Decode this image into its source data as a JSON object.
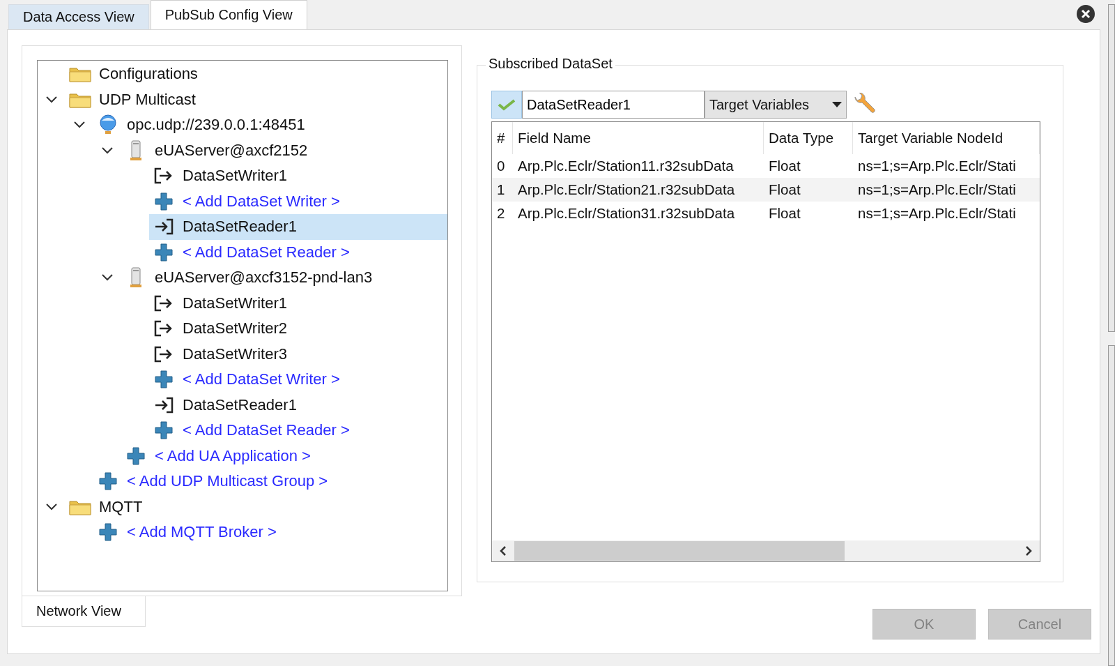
{
  "tabs": [
    {
      "label": "Data Access View",
      "selected": false
    },
    {
      "label": "PubSub Config View",
      "selected": true
    }
  ],
  "tree": [
    {
      "kind": "folder",
      "label": "Configurations",
      "selected": false
    },
    {
      "kind": "folder",
      "label": "UDP Multicast",
      "expanded": true,
      "selected": false,
      "children": [
        {
          "kind": "globe",
          "label": "opc.udp://239.0.0.1:48451",
          "expanded": true,
          "selected": false,
          "children": [
            {
              "kind": "server",
              "label": "eUAServer@axcf2152",
              "expanded": true,
              "selected": false,
              "children": [
                {
                  "kind": "writer",
                  "label": "DataSetWriter1",
                  "selected": false
                },
                {
                  "kind": "add",
                  "label": "< Add DataSet Writer >",
                  "selected": false
                },
                {
                  "kind": "reader",
                  "label": "DataSetReader1",
                  "selected": true
                },
                {
                  "kind": "add",
                  "label": "< Add DataSet Reader >",
                  "selected": false
                }
              ]
            },
            {
              "kind": "server",
              "label": "eUAServer@axcf3152-pnd-lan3",
              "expanded": true,
              "selected": false,
              "children": [
                {
                  "kind": "writer",
                  "label": "DataSetWriter1",
                  "selected": false
                },
                {
                  "kind": "writer",
                  "label": "DataSetWriter2",
                  "selected": false
                },
                {
                  "kind": "writer",
                  "label": "DataSetWriter3",
                  "selected": false
                },
                {
                  "kind": "add",
                  "label": "< Add DataSet Writer >",
                  "selected": false
                },
                {
                  "kind": "reader",
                  "label": "DataSetReader1",
                  "selected": false
                },
                {
                  "kind": "add",
                  "label": "< Add DataSet Reader >",
                  "selected": false
                }
              ]
            },
            {
              "kind": "add",
              "label": "< Add UA Application >",
              "selected": false
            }
          ]
        },
        {
          "kind": "add",
          "label": "< Add UDP Multicast Group >",
          "selected": false
        }
      ]
    },
    {
      "kind": "folder",
      "label": "MQTT",
      "expanded": true,
      "selected": false,
      "children": [
        {
          "kind": "add",
          "label": "< Add MQTT Broker >",
          "selected": false
        }
      ]
    }
  ],
  "bottom_tab": {
    "label": "Network View",
    "selected": true
  },
  "subscribed_dataset": {
    "title": "Subscribed DataSet",
    "name_field": {
      "value": "DataSetReader1"
    },
    "view_dropdown": {
      "value": "Target Variables"
    },
    "table": {
      "columns": [
        "#",
        "Field Name",
        "Data Type",
        "Target Variable NodeId"
      ],
      "rows": [
        [
          "0",
          "Arp.Plc.Eclr/Station11.r32subData",
          "Float",
          "ns=1;s=Arp.Plc.Eclr/Stati"
        ],
        [
          "1",
          "Arp.Plc.Eclr/Station21.r32subData",
          "Float",
          "ns=1;s=Arp.Plc.Eclr/Stati"
        ],
        [
          "2",
          "Arp.Plc.Eclr/Station31.r32subData",
          "Float",
          "ns=1;s=Arp.Plc.Eclr/Stati"
        ]
      ]
    }
  },
  "buttons": [
    {
      "label": "OK",
      "disabled": true
    },
    {
      "label": "Cancel",
      "disabled": true
    }
  ]
}
